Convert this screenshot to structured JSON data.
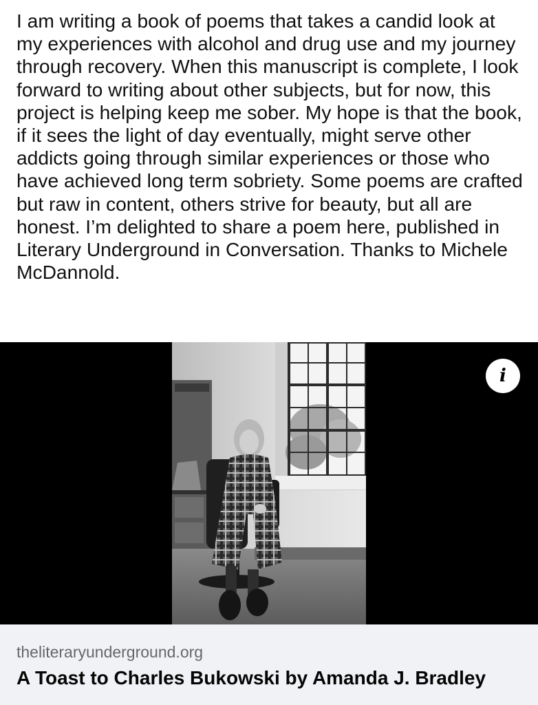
{
  "post": {
    "text": "I am writing a book of poems that takes a candid look at my experiences with alcohol and drug use and my journey through recovery. When this manuscript is complete, I look forward to writing about other subjects, but for now, this project is helping keep me sober. My hope is that the book, if it sees the light of day eventually, might serve other addicts going through similar experiences or those who have achieved long term sobriety. Some poems are crafted but raw in content, others strive for beauty, but all are honest. I’m delighted to share a poem here, published in Literary Underground in Conversation. Thanks to Michele McDannold."
  },
  "media": {
    "info_icon": "info-icon",
    "info_glyph": "i"
  },
  "link_card": {
    "domain": "theliteraryunderground.org",
    "title": "A Toast to Charles Bukowski by Amanda J. Bradley"
  },
  "colors": {
    "media_background": "#000000",
    "card_background": "#f0f2f5",
    "domain_text": "#65676b",
    "title_text": "#050505"
  }
}
